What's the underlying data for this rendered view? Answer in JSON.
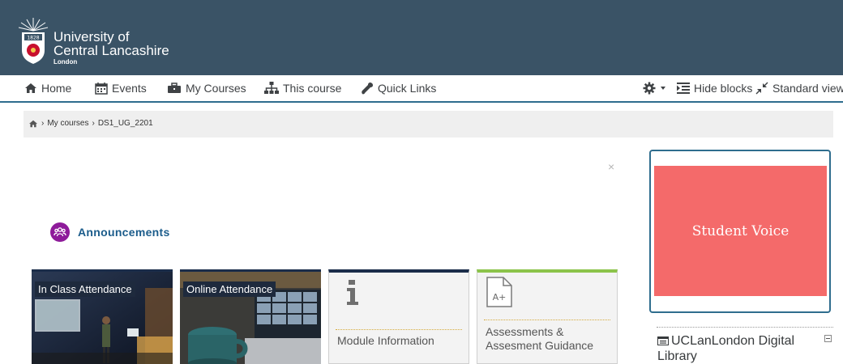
{
  "header": {
    "logo": {
      "year": "1828"
    },
    "brand_line1": "University of",
    "brand_line2": "Central Lancashire",
    "brand_line3": "London"
  },
  "nav": {
    "home": "Home",
    "events": "Events",
    "my_courses": "My Courses",
    "this_course": "This course",
    "quick_links": "Quick Links",
    "hide_blocks": "Hide blocks",
    "standard_view": "Standard view"
  },
  "breadcrumb": {
    "items": [
      "My courses",
      "DS1_UG_2201"
    ],
    "separator": "›"
  },
  "close": "×",
  "announcements": {
    "label": "Announcements"
  },
  "tiles": [
    {
      "label": "In Class Attendance"
    },
    {
      "label": "Online Attendance"
    },
    {
      "label": "Module Information"
    },
    {
      "label": "Assessments &",
      "label2": "Assesment Guidance",
      "badge": "A+"
    }
  ],
  "sidebar": {
    "student_voice": "Student Voice",
    "library_title": "UCLanLondon Digital Library"
  },
  "colors": {
    "header_bg": "#3a5366",
    "accent": "#2f6d8e",
    "student_voice_bg": "#f46a6a",
    "announcement_icon": "#8e1b9a",
    "link": "#1b5c8b"
  }
}
